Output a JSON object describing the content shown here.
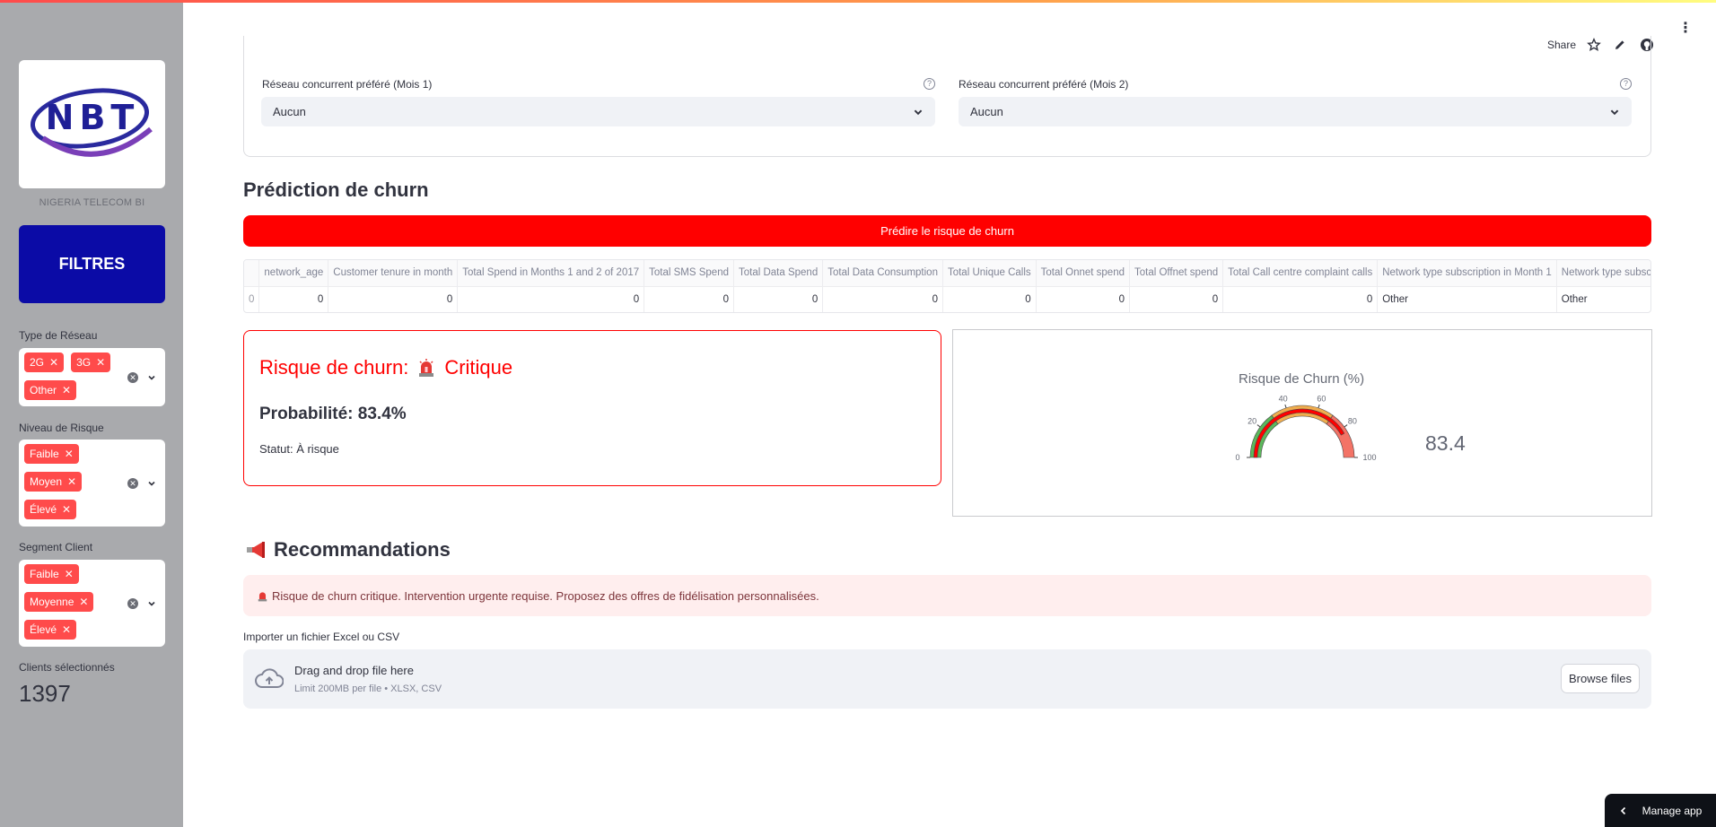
{
  "sidebar": {
    "logo_text": "NBT",
    "logo_caption": "NIGERIA TELECOM BI",
    "filters_title": "FILTRES",
    "network_type": {
      "label": "Type de Réseau",
      "tags": [
        "2G",
        "3G",
        "Other"
      ]
    },
    "risk_level": {
      "label": "Niveau de Risque",
      "tags": [
        "Faible",
        "Moyen",
        "Élevé"
      ]
    },
    "segment": {
      "label": "Segment Client",
      "tags": [
        "Faible",
        "Moyenne",
        "Élevé"
      ]
    },
    "clients_label": "Clients sélectionnés",
    "clients_count": "1397"
  },
  "header": {
    "share_label": "Share",
    "icons": [
      "star-icon",
      "pencil-icon",
      "github-icon",
      "more-vert-icon"
    ]
  },
  "form": {
    "competitor_m1": {
      "label": "Réseau concurrent préféré (Mois 1)",
      "value": "Aucun",
      "help": "?"
    },
    "competitor_m2": {
      "label": "Réseau concurrent préféré (Mois 2)",
      "value": "Aucun",
      "help": "?"
    }
  },
  "prediction": {
    "heading": "Prédiction de churn",
    "button_label": "Prédire le risque de churn",
    "table": {
      "columns": [
        "",
        "network_age",
        "Customer tenure in month",
        "Total Spend in Months 1 and 2 of 2017",
        "Total SMS Spend",
        "Total Data Spend",
        "Total Data Consumption",
        "Total Unique Calls",
        "Total Onnet spend",
        "Total Offnet spend",
        "Total Call centre complaint calls",
        "Network type subscription in Month 1",
        "Network type subscrip"
      ],
      "row": [
        "0",
        "0",
        "0",
        "0",
        "0",
        "0",
        "0",
        "0",
        "0",
        "0",
        "0",
        "Other",
        "Other"
      ]
    }
  },
  "risk": {
    "title_prefix": "Risque de churn:",
    "level": "Critique",
    "probability": "Probabilité: 83.4%",
    "status": "Statut: À risque"
  },
  "gauge": {
    "title": "Risque de Churn (%)",
    "value": 83.4,
    "value_text": "83.4",
    "ticks": [
      "0",
      "20",
      "40",
      "60",
      "80",
      "100"
    ],
    "colors": {
      "low": "#5cb85c",
      "mid": "#f0ad4e",
      "high": "#f37366",
      "bar": "#ff0000"
    }
  },
  "recommendations": {
    "heading": "Recommandations",
    "alert": "Risque de churn critique. Intervention urgente requise. Proposez des offres de fidélisation personnalisées."
  },
  "upload": {
    "label": "Importer un fichier Excel ou CSV",
    "drop_title": "Drag and drop file here",
    "drop_sub": "Limit 200MB per file • XLSX, CSV",
    "browse_label": "Browse files"
  },
  "manage_app": "Manage app"
}
